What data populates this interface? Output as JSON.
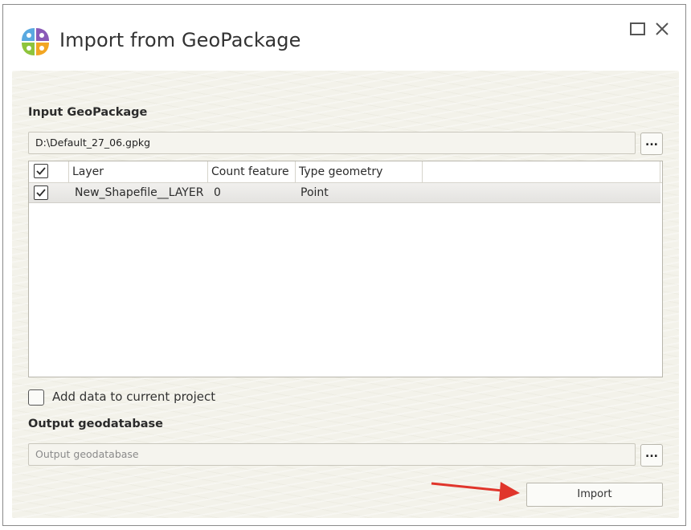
{
  "window": {
    "title": "Import from GeoPackage"
  },
  "input": {
    "section_label": "Input GeoPackage",
    "path_value": "D:\\Default_27_06.gpkg",
    "browse_label": "..."
  },
  "grid": {
    "columns": [
      "Layer",
      "Count feature",
      "Type geometry"
    ],
    "rows": [
      {
        "checked": true,
        "layer": "New_Shapefile__LAYER",
        "count": "0",
        "type": "Point"
      }
    ],
    "select_all_checked": true
  },
  "options": {
    "add_to_project_label": "Add data to current project",
    "add_to_project_checked": false
  },
  "output": {
    "section_label": "Output geodatabase",
    "placeholder": "Output geodatabase",
    "browse_label": "..."
  },
  "actions": {
    "import_label": "Import"
  },
  "colors": {
    "panel_bg": "#f3f2ea",
    "annotation_arrow": "#e0352b"
  },
  "icons": [
    "app-logo-icon",
    "maximize-icon",
    "close-icon",
    "checkmark-icon",
    "annotation-arrow-icon"
  ]
}
